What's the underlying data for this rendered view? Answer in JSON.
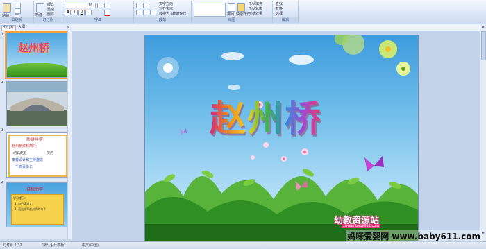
{
  "ribbon": {
    "groups": [
      "剪贴板",
      "幻灯片",
      "字体",
      "段落",
      "绘图",
      "编辑"
    ],
    "slide_buttons": [
      "新建",
      "幻灯片",
      "版式",
      "重设",
      "删除"
    ],
    "paste_label": "粘贴",
    "font_size": "18",
    "paragraph_items": [
      "文字方向",
      "对齐文本",
      "转换为 SmartArt"
    ],
    "drawing_items": [
      "排列",
      "快速样式",
      "形状填充",
      "形状轮廓",
      "形状效果"
    ],
    "edit_items": [
      "查找",
      "替换",
      "选择"
    ]
  },
  "panel": {
    "tabs": [
      "幻灯片",
      "大纲"
    ],
    "close": "×"
  },
  "thumbnails": [
    {
      "num": "1",
      "title": "赵州桥"
    },
    {
      "num": "2",
      "title": ""
    },
    {
      "num": "3",
      "title": "质疑导学",
      "lines": [
        "赵州桥资料简介:",
        "河北赵县",
        "洨河",
        "李春设计和主持建造",
        "一千四百多年"
      ]
    },
    {
      "num": "4",
      "title": "自我助学",
      "lines": [
        "学习提示:",
        "1. 自己读课文",
        "2. 画出描写赵州桥的句子"
      ]
    }
  ],
  "slide": {
    "title": "赵州桥",
    "brand": "幼教资源站",
    "brand_url": "ziyuan.baby611.com"
  },
  "status": {
    "slide_count": "幻灯片 1/31",
    "theme": "\"默认设计模板\"",
    "language": "中文(中国)"
  },
  "watermark": "妈咪爱婴网 www.baby611.com",
  "colors": {
    "ribbon": "#dce7f6",
    "accent": "#f2a33b",
    "sky_top": "#3e9cdd"
  }
}
